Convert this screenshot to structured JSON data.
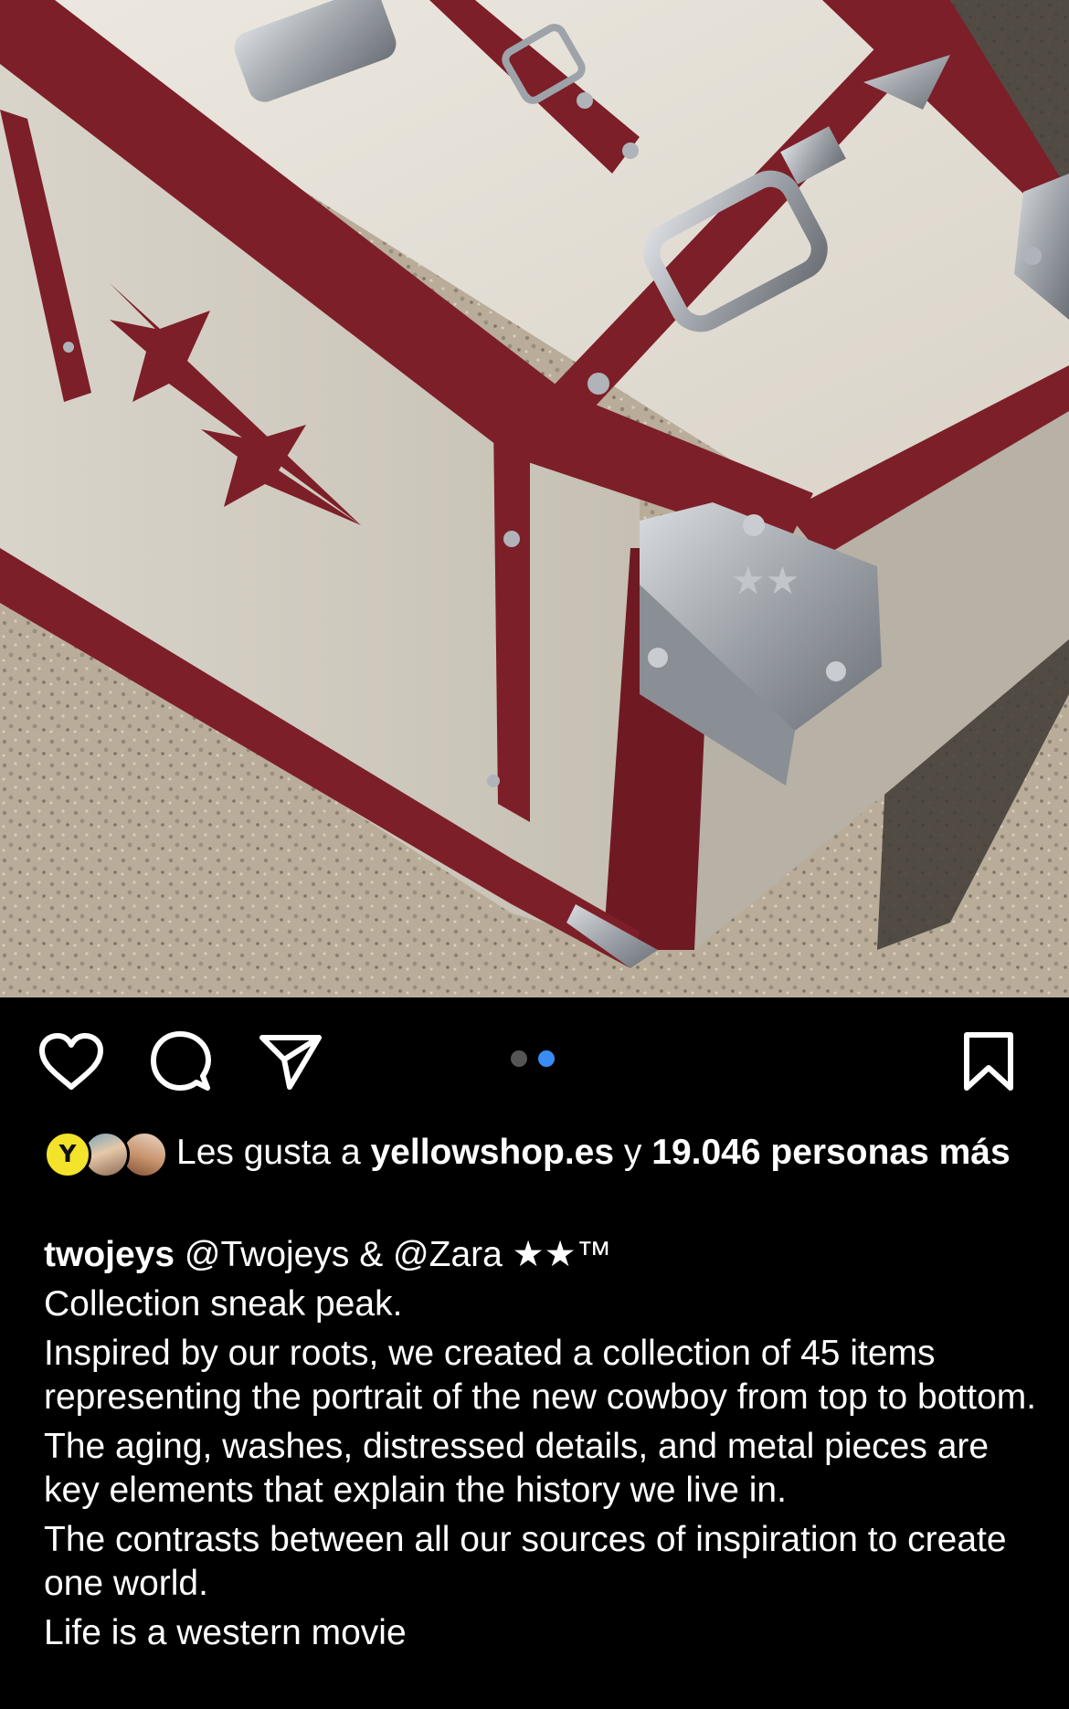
{
  "post": {
    "image_alt": "Cream and burgundy leather trunk with silver buckle and corner hardware",
    "carousel": {
      "total": 2,
      "active_index": 2
    }
  },
  "actions": {
    "like_icon": "heart-icon",
    "comment_icon": "comment-icon",
    "share_icon": "send-icon",
    "save_icon": "bookmark-icon"
  },
  "likes": {
    "prefix": "Les gusta a ",
    "first_user": "yellowshop.es",
    "middle": " y ",
    "count_text": "19.046 personas más",
    "avatar_letter": "Y"
  },
  "caption": {
    "username": "twojeys",
    "headline_rest": " @Twojeys & @Zara ★★™",
    "lines": [
      "Collection sneak peak.",
      "Inspired by our roots, we created a collection of 45 items representing the portrait of the new cowboy from top to bottom.",
      "The aging, washes, distressed details, and metal pieces are key elements that explain the history we live in.",
      "The contrasts between all our sources of inspiration to create one world.",
      "Life is a western movie"
    ]
  },
  "colors": {
    "background": "#000000",
    "text": "#ffffff",
    "carousel_active": "#3a8cf4",
    "carousel_inactive": "#555555",
    "trunk_burgundy": "#7d1f28",
    "trunk_cream": "#e6e1d8"
  }
}
